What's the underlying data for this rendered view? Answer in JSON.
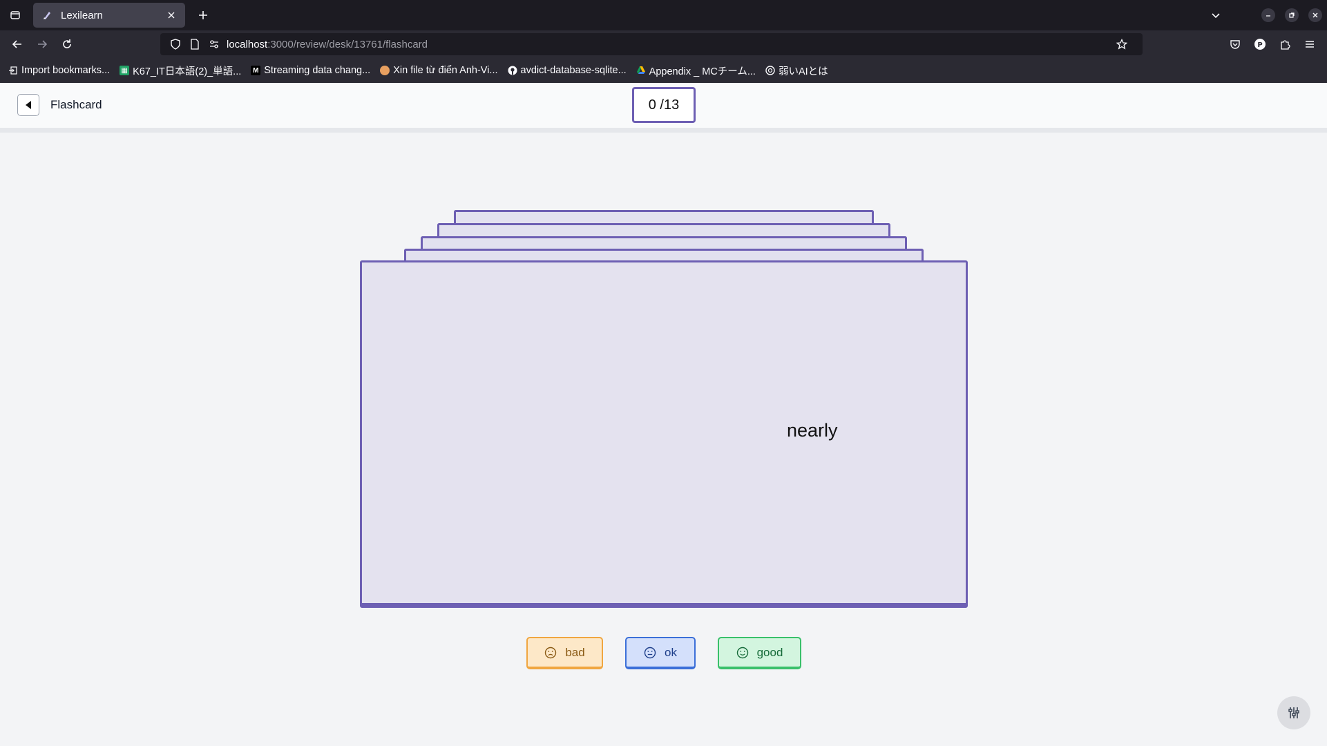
{
  "browser": {
    "tab": {
      "title": "Lexilearn"
    },
    "url": {
      "host": "localhost",
      "path": ":3000/review/desk/13761/flashcard"
    },
    "bookmarks": [
      {
        "label": "Import bookmarks...",
        "icon": "import-icon"
      },
      {
        "label": "K67_IT日本語(2)_単語...",
        "icon": "sheets-icon",
        "color": "#21a366"
      },
      {
        "label": "Streaming data chang...",
        "icon": "medium-icon",
        "color": "#000000"
      },
      {
        "label": "Xin file từ điển Anh-Vi...",
        "icon": "avatar-icon",
        "color": "#e8a060"
      },
      {
        "label": "avdict-database-sqlite...",
        "icon": "github-icon",
        "color": "#ffffff"
      },
      {
        "label": "Appendix _ MCチーム...",
        "icon": "drive-icon",
        "color": "#fbbc04"
      },
      {
        "label": "弱いAIとは",
        "icon": "openai-icon",
        "color": "#ffffff"
      }
    ]
  },
  "app": {
    "header": {
      "title": "Flashcard",
      "counter": "0 /13"
    },
    "card": {
      "word": "nearly"
    },
    "ratings": [
      {
        "label": "bad",
        "icon": "smiley-sad-icon"
      },
      {
        "label": "ok",
        "icon": "smiley-neutral-icon"
      },
      {
        "label": "good",
        "icon": "smiley-happy-icon"
      }
    ],
    "settings_icon": "sliders-icon",
    "colors": {
      "accent": "#6d5fb3",
      "card": "#e4e2ef"
    }
  }
}
